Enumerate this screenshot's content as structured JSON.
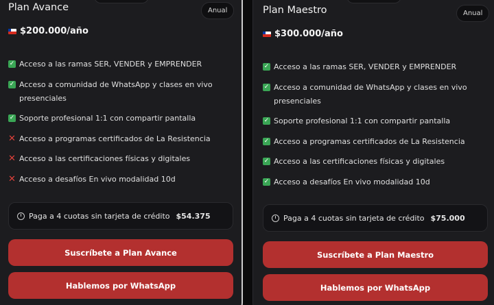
{
  "plans": [
    {
      "name": "Plan Avance",
      "period": "Anual",
      "flag_icon": "chile-flag-icon",
      "price": "$200.000/año",
      "features": [
        {
          "icon": "check",
          "text": "Acceso a las ramas SER, VENDER y EMPRENDER"
        },
        {
          "icon": "check",
          "text": "Acceso a comunidad de WhatsApp y clases en vivo presenciales"
        },
        {
          "icon": "check",
          "text": "Soporte profesional 1:1 con compartir pantalla"
        },
        {
          "icon": "cross",
          "text": "Acceso a programas certificados de La Resistencia"
        },
        {
          "icon": "cross",
          "text": "Acceso a las certificaciones físicas y digitales"
        },
        {
          "icon": "cross",
          "text": "Acceso a desafíos En vivo modalidad 10d"
        }
      ],
      "installments_text": "Paga a 4 cuotas sin tarjeta de crédito",
      "installments_amount": "$54.375",
      "subscribe_label": "Suscríbete a Plan Avance",
      "whatsapp_label": "Hablemos por WhatsApp"
    },
    {
      "name": "Plan Maestro",
      "period": "Anual",
      "flag_icon": "chile-flag-icon",
      "price": "$300.000/año",
      "features": [
        {
          "icon": "check",
          "text": "Acceso a las ramas SER, VENDER y EMPRENDER"
        },
        {
          "icon": "check",
          "text": "Acceso a comunidad de WhatsApp y clases en vivo presenciales"
        },
        {
          "icon": "check",
          "text": "Soporte profesional 1:1 con compartir pantalla"
        },
        {
          "icon": "check",
          "text": "Acceso a programas certificados de La Resistencia"
        },
        {
          "icon": "check",
          "text": "Acceso a las certificaciones físicas y digitales"
        },
        {
          "icon": "check",
          "text": "Acceso a desafíos En vivo modalidad 10d"
        }
      ],
      "installments_text": "Paga a 4 cuotas sin tarjeta de crédito",
      "installments_amount": "$75.000",
      "subscribe_label": "Suscríbete a Plan Maestro",
      "whatsapp_label": "Hablemos por WhatsApp"
    }
  ],
  "colors": {
    "background": "#0b0b0c",
    "card": "#1c1c1f",
    "button": "#b3302f",
    "check": "#3aa655",
    "cross": "#e0413a"
  }
}
